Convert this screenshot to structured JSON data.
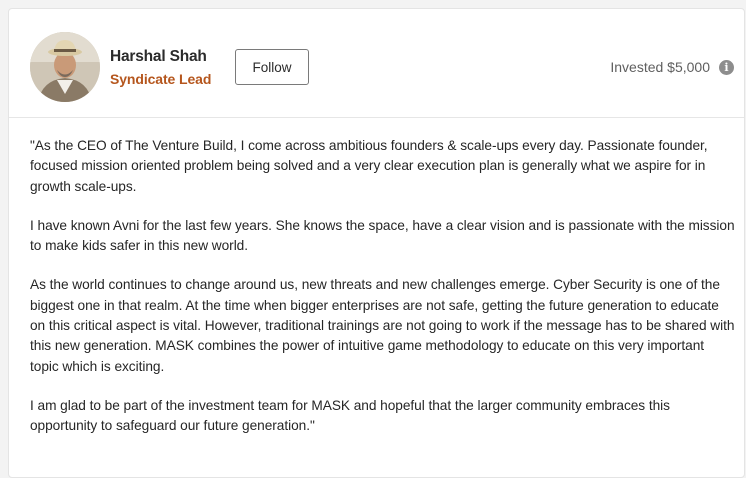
{
  "profile": {
    "name": "Harshal Shah",
    "role": "Syndicate Lead",
    "avatar_icon": "person-photo"
  },
  "follow": {
    "label": "Follow"
  },
  "investment": {
    "text": "Invested $5,000",
    "info_icon": "info-icon"
  },
  "testimonial": {
    "paragraphs": [
      "\"As the CEO of The Venture Build, I come across ambitious founders & scale-ups every day. Passionate founder, focused mission oriented problem being solved and a very clear execution plan is generally what we aspire for in growth scale-ups.",
      "I have known Avni for the last few years. She knows the space, have a clear vision and is passionate with the mission to make kids safer in this new world.",
      "As the world continues to change around us, new threats and new challenges emerge. Cyber Security is one of the biggest one in that realm. At the time when bigger enterprises are not safe, getting the future generation to educate on this critical aspect is vital. However, traditional trainings are not going to work if the message has to be shared with this new generation. MASK combines the power of intuitive game methodology to educate on this very important topic which is exciting.",
      "I am glad to be part of the investment team for MASK and hopeful that the larger community embraces this opportunity to safeguard our future generation.\""
    ]
  },
  "colors": {
    "role": "#b5561d",
    "text": "#262626",
    "muted": "#5f5f5f"
  }
}
